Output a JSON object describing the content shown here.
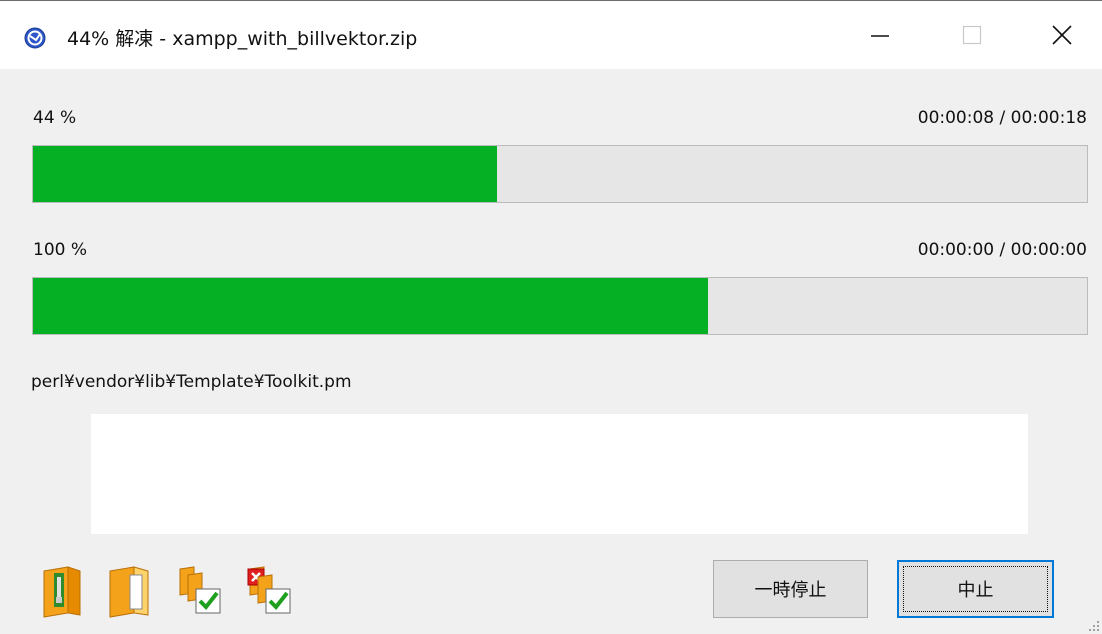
{
  "window": {
    "title": "44% 解凍 - xampp_with_billvektor.zip"
  },
  "progress": {
    "total": {
      "percent_label": "44 %",
      "time_label": "00:00:08 / 00:00:18",
      "fill_fraction": 0.44
    },
    "file": {
      "percent_label": "100 %",
      "time_label": "00:00:00 / 00:00:00",
      "fill_fraction": 0.64
    }
  },
  "current_file": "perl¥vendor¥lib¥Template¥Toolkit.pm",
  "toolbar_icons": [
    "archive-folder-icon",
    "open-folder-icon",
    "copy-check-icon",
    "delete-check-icon"
  ],
  "buttons": {
    "pause": "一時停止",
    "stop": "中止"
  },
  "colors": {
    "progress_fill": "#06b025",
    "progress_track": "#e6e6e6",
    "focus_border": "#0078d7"
  }
}
